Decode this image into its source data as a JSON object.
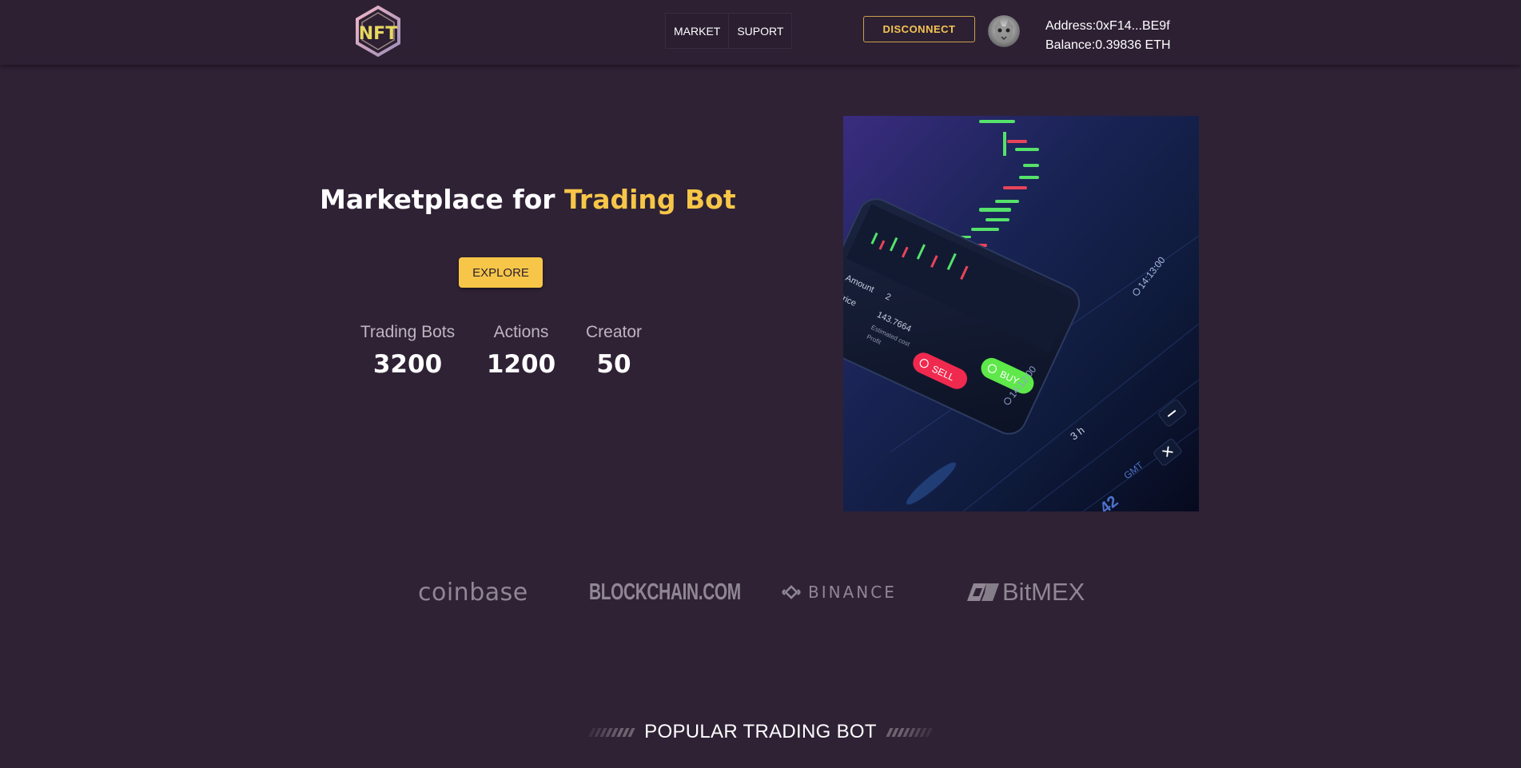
{
  "header": {
    "logo_text": "NFT",
    "nav": [
      "MARKET",
      "SUPORT"
    ],
    "disconnect_label": "DISCONNECT",
    "wallet": {
      "address": "Address:0xF14...BE9f",
      "balance": "Balance:0.39836 ETH"
    }
  },
  "hero": {
    "title_prefix": "Marketplace for ",
    "title_accent": "Trading Bot",
    "explore_label": "EXPLORE",
    "stats": [
      {
        "label": "Trading Bots",
        "value": "3200"
      },
      {
        "label": "Actions",
        "value": "1200"
      },
      {
        "label": "Creator",
        "value": "50"
      }
    ],
    "image": {
      "amount_label": "Amount",
      "amount_value": "2",
      "price_label": "Price",
      "price_value": "143.7664",
      "est_cost_label": "Estimated cost",
      "profit_label": "Profit",
      "sell_label": "SELL",
      "buy_label": "BUY",
      "time_1": "14:12:00",
      "time_2": "14:13:00",
      "interval": "3 h",
      "gmt_label": "GMT",
      "corner_number": "42"
    }
  },
  "partners": [
    "coinbase",
    "BLOCKCHAIN.COM",
    "BINANCE",
    "BitMEX"
  ],
  "popular": {
    "title": "POPULAR TRADING BOT"
  },
  "colors": {
    "background": "#2f2235",
    "accent": "#f7c648",
    "muted": "#bdb6c0",
    "sell": "#f0294f",
    "buy": "#5ee84a"
  }
}
